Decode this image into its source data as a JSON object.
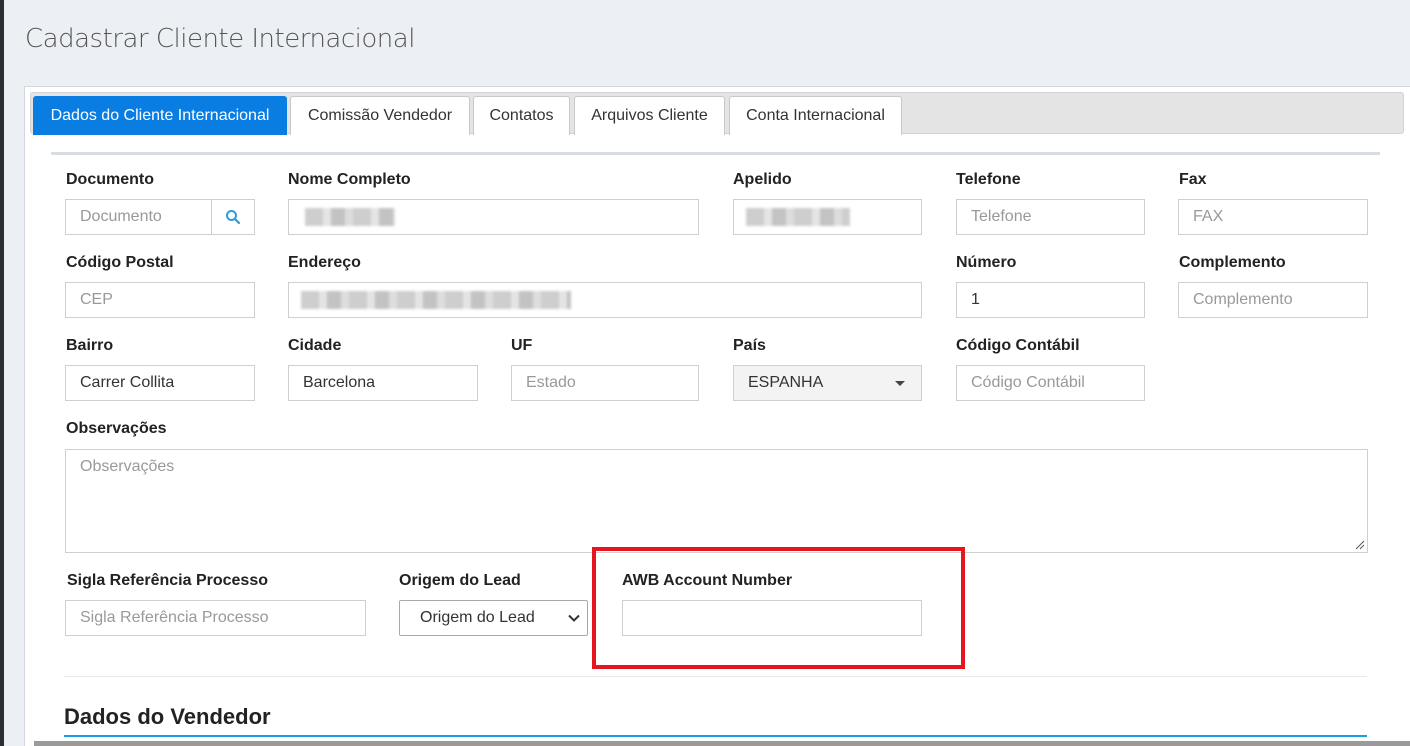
{
  "page": {
    "title": "Cadastrar Cliente Internacional"
  },
  "tabs": [
    {
      "label": "Dados do Cliente Internacional",
      "active": true
    },
    {
      "label": "Comissão Vendedor"
    },
    {
      "label": "Contatos"
    },
    {
      "label": "Arquivos Cliente"
    },
    {
      "label": "Conta Internacional"
    }
  ],
  "form": {
    "documento": {
      "label": "Documento",
      "placeholder": "Documento",
      "value": ""
    },
    "nome": {
      "label": "Nome Completo"
    },
    "apelido": {
      "label": "Apelido"
    },
    "telefone": {
      "label": "Telefone",
      "placeholder": "Telefone",
      "value": ""
    },
    "fax": {
      "label": "Fax",
      "placeholder": "FAX",
      "value": ""
    },
    "cep": {
      "label": "Código Postal",
      "placeholder": "CEP",
      "value": ""
    },
    "endereco": {
      "label": "Endereço"
    },
    "numero": {
      "label": "Número",
      "value": "1"
    },
    "complemento": {
      "label": "Complemento",
      "placeholder": "Complemento",
      "value": ""
    },
    "bairro": {
      "label": "Bairro",
      "value": "Carrer Collita"
    },
    "cidade": {
      "label": "Cidade",
      "value": "Barcelona"
    },
    "uf": {
      "label": "UF",
      "placeholder": "Estado",
      "value": ""
    },
    "pais": {
      "label": "País",
      "selected": "ESPANHA"
    },
    "codigo_contabil": {
      "label": "Código Contábil",
      "placeholder": "Código Contábil",
      "value": ""
    },
    "observacoes": {
      "label": "Observações",
      "placeholder": "Observações",
      "value": ""
    },
    "sigla": {
      "label": "Sigla Referência Processo",
      "placeholder": "Sigla Referência Processo",
      "value": ""
    },
    "origem": {
      "label": "Origem do Lead",
      "selected": "Origem do Lead"
    },
    "awb": {
      "label": "AWB Account Number",
      "value": ""
    }
  },
  "section": {
    "title": "Dados do Vendedor"
  },
  "colors": {
    "accent": "#0a7de2",
    "highlight": "#e5161e",
    "section_line": "#17a0e0",
    "search_icon": "#2a9fd6"
  },
  "icons": {
    "search": "search-icon",
    "dropdown": "caret-down-icon",
    "select": "chevron-down-icon",
    "resize": "resize-grip-icon"
  }
}
